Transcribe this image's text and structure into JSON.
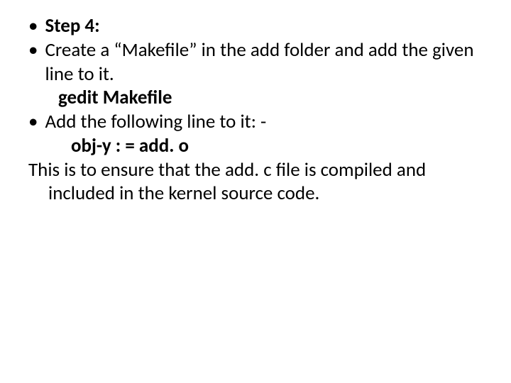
{
  "bullets": {
    "b1_bold": "Step 4:",
    "b2_pre": "Create a ",
    "b2_quoted": "“Makefile”",
    "b2_post": " in the add folder and add the given line to it.",
    "b2_cmd": "gedit Makefile",
    "b3_text": "Add the following line to it: -",
    "b3_cmd": "obj-y : = add. o"
  },
  "paragraph": {
    "line1": "This is to ensure that the add. c file is compiled and",
    "line2": "included in the kernel source code."
  },
  "glyphs": {
    "dot": "•"
  }
}
